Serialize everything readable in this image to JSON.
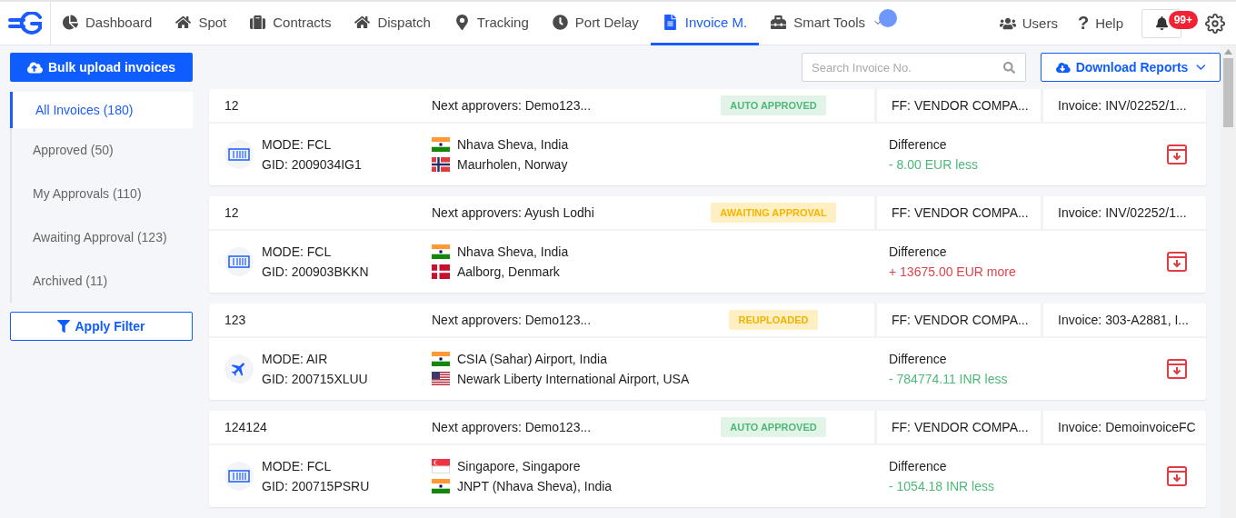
{
  "nav": {
    "items": [
      {
        "label": "Dashboard",
        "kind": "chart",
        "selected": false
      },
      {
        "label": "Spot",
        "kind": "home",
        "selected": false
      },
      {
        "label": "Contracts",
        "kind": "briefcase",
        "selected": false
      },
      {
        "label": "Dispatch",
        "kind": "home",
        "selected": false
      },
      {
        "label": "Tracking",
        "kind": "pin",
        "selected": false
      },
      {
        "label": "Port Delay",
        "kind": "clock",
        "selected": false
      },
      {
        "label": "Invoice M.",
        "kind": "file",
        "selected": true
      },
      {
        "label": "Smart Tools",
        "kind": "toolbox",
        "selected": false,
        "dropdown": true
      }
    ],
    "users": "Users",
    "help_icon": "?",
    "help": "Help",
    "notifications": "99+"
  },
  "sidebar": {
    "upload_button": "Bulk upload invoices",
    "items": [
      {
        "label": "All Invoices (180)",
        "selected": true
      },
      {
        "label": "Approved (50)",
        "selected": false
      },
      {
        "label": "My Approvals (110)",
        "selected": false
      },
      {
        "label": "Awaiting Approval (123)",
        "selected": false
      },
      {
        "label": "Archived (11)",
        "selected": false
      }
    ],
    "filter_button": "Apply Filter"
  },
  "toolbar": {
    "search": {
      "placeholder": "Search Invoice No."
    },
    "download_button": "Download Reports"
  },
  "invoices": [
    {
      "number": "12",
      "approvers": "Next approvers: Demo123...",
      "status": {
        "label": "AUTO APPROVED",
        "kind": "auto"
      },
      "ff": "FF: VENDOR COMPA...",
      "invoice": "Invoice: INV/02252/1...",
      "kind": "container",
      "mode": "MODE: FCL",
      "gid": "GID: 2009034IG1",
      "origin": {
        "kind": "india",
        "name": "Nhava Sheva, India"
      },
      "destination": {
        "kind": "norway",
        "name": "Maurholen, Norway"
      },
      "difference_label": "Difference",
      "difference": {
        "text": "- 8.00 EUR less",
        "kind": "less"
      }
    },
    {
      "number": "12",
      "approvers": "Next approvers: Ayush Lodhi",
      "status": {
        "label": "AWAITING APPROVAL",
        "kind": "awaiting"
      },
      "ff": "FF: VENDOR COMPA...",
      "invoice": "Invoice: INV/02252/1...",
      "kind": "container",
      "mode": "MODE: FCL",
      "gid": "GID: 200903BKKN",
      "origin": {
        "kind": "india",
        "name": "Nhava Sheva, India"
      },
      "destination": {
        "kind": "denmark",
        "name": "Aalborg, Denmark"
      },
      "difference_label": "Difference",
      "difference": {
        "text": "+ 13675.00 EUR more",
        "kind": "more"
      }
    },
    {
      "number": "123",
      "approvers": "Next approvers: Demo123...",
      "status": {
        "label": "REUPLOADED",
        "kind": "reuploaded"
      },
      "ff": "FF: VENDOR COMPA...",
      "invoice": "Invoice: 303-A2881, I...",
      "kind": "plane",
      "mode": "MODE: AIR",
      "gid": "GID: 200715XLUU",
      "origin": {
        "kind": "india",
        "name": "CSIA (Sahar) Airport, India"
      },
      "destination": {
        "kind": "usa",
        "name": "Newark Liberty International Airport, USA"
      },
      "difference_label": "Difference",
      "difference": {
        "text": "- 784774.11 INR less",
        "kind": "less"
      }
    },
    {
      "number": "124124",
      "approvers": "Next approvers: Demo123...",
      "status": {
        "label": "AUTO APPROVED",
        "kind": "auto"
      },
      "ff": "FF: VENDOR COMPA...",
      "invoice": "Invoice: DemoinvoiceFC",
      "kind": "container",
      "mode": "MODE: FCL",
      "gid": "GID: 200715PSRU",
      "origin": {
        "kind": "singapore",
        "name": "Singapore, Singapore"
      },
      "destination": {
        "kind": "india",
        "name": "JNPT (Nhava Sheva), India"
      },
      "difference_label": "Difference",
      "difference": {
        "text": "- 1054.18 INR less",
        "kind": "less"
      }
    }
  ]
}
